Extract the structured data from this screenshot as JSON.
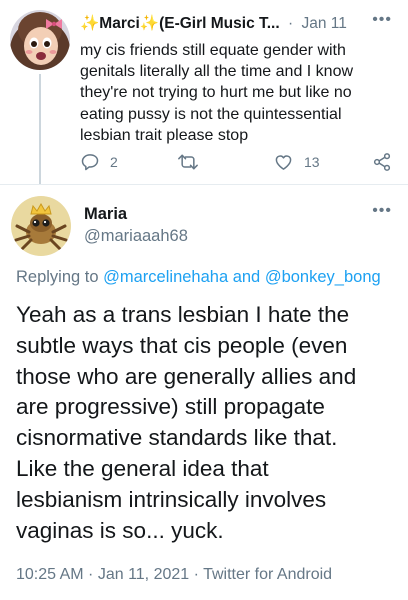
{
  "parent_tweet": {
    "display_name": "✨Marci✨(E-Girl Music T...",
    "separator": "·",
    "date": "Jan 11",
    "text": "my cis friends still equate gender with\ngenitals literally all the time and I know\nthey're not trying to hurt me but like  no\neating pussy is not the quintessential\nlesbian trait please stop",
    "reply_count": "2",
    "retweet_count": "",
    "like_count": "13"
  },
  "main_tweet": {
    "display_name": "Maria",
    "handle": "@mariaaah68",
    "replying_prefix": "Replying to ",
    "replying_user_1": "@marcelinehaha",
    "replying_and": " and ",
    "replying_user_2": "@bonkey_bong",
    "text": "Yeah as a trans lesbian I hate the\nsubtle ways that cis people (even\nthose who are generally allies and\nare progressive) still propagate\ncisnormative standards like that.\nLike the general idea that\nlesbianism intrinsically involves\nvaginas is so... yuck.",
    "timestamp": "10:25 AM · Jan 11, 2021 · ",
    "source": "Twitter for Android"
  },
  "icons": {
    "more": "more-icon",
    "reply": "reply-icon",
    "retweet": "retweet-icon",
    "like": "heart-icon",
    "share": "share-icon"
  },
  "colors": {
    "link": "#1da1f2",
    "secondary_text": "#657786",
    "primary_text": "#14171a",
    "divider": "#e6ecf0"
  }
}
